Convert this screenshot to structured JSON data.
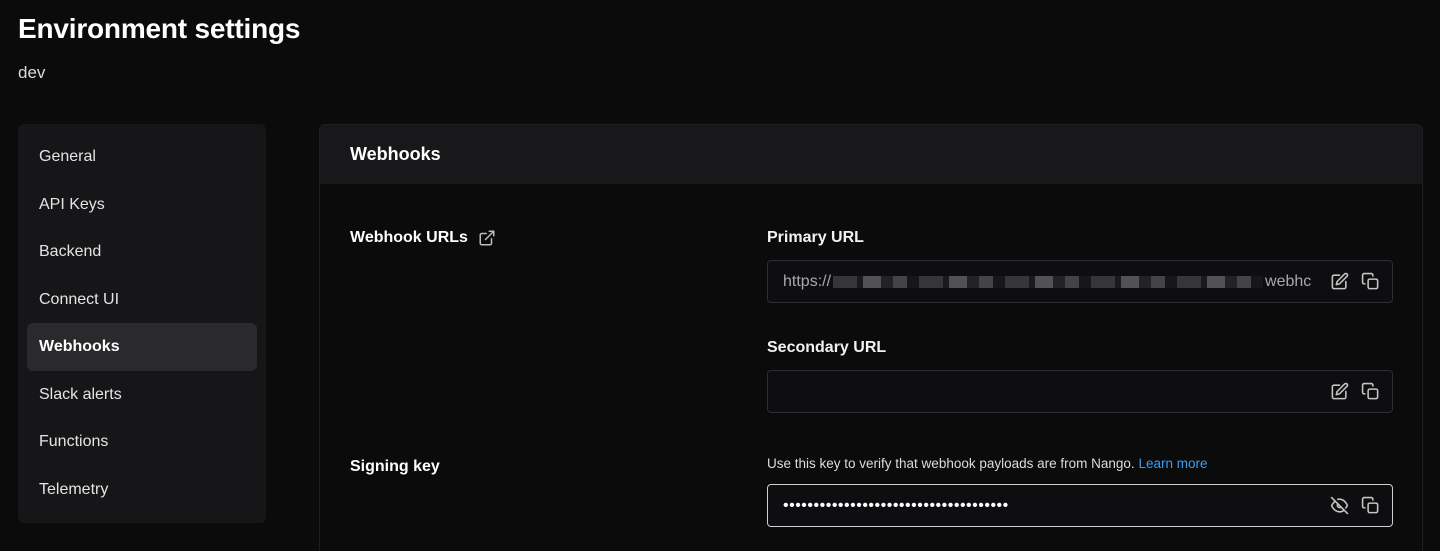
{
  "page": {
    "title": "Environment settings",
    "environment": "dev"
  },
  "sidebar": {
    "items": [
      {
        "label": "General"
      },
      {
        "label": "API Keys"
      },
      {
        "label": "Backend"
      },
      {
        "label": "Connect UI"
      },
      {
        "label": "Webhooks",
        "active": true
      },
      {
        "label": "Slack alerts"
      },
      {
        "label": "Functions"
      },
      {
        "label": "Telemetry"
      }
    ]
  },
  "webhooks": {
    "section_title": "Webhooks",
    "urls_label": "Webhook URLs",
    "urls_label_icon": "external-link-icon",
    "primary": {
      "label": "Primary URL",
      "value_prefix": "https://",
      "value_suffix": "webhc"
    },
    "secondary": {
      "label": "Secondary URL",
      "value": ""
    },
    "signing": {
      "label": "Signing key",
      "help_text": "Use this key to verify that webhook payloads are from Nango.",
      "help_link": "Learn more",
      "masked_value": "•••••••••••••••••••••••••••••••••••••"
    },
    "icons": {
      "edit": "edit-icon",
      "copy": "copy-icon",
      "hide": "eye-off-icon"
    }
  },
  "colors": {
    "background": "#0b0b0c",
    "sidebar": "#161618",
    "active_item": "#2a2a2d",
    "link": "#3b9cf3"
  }
}
